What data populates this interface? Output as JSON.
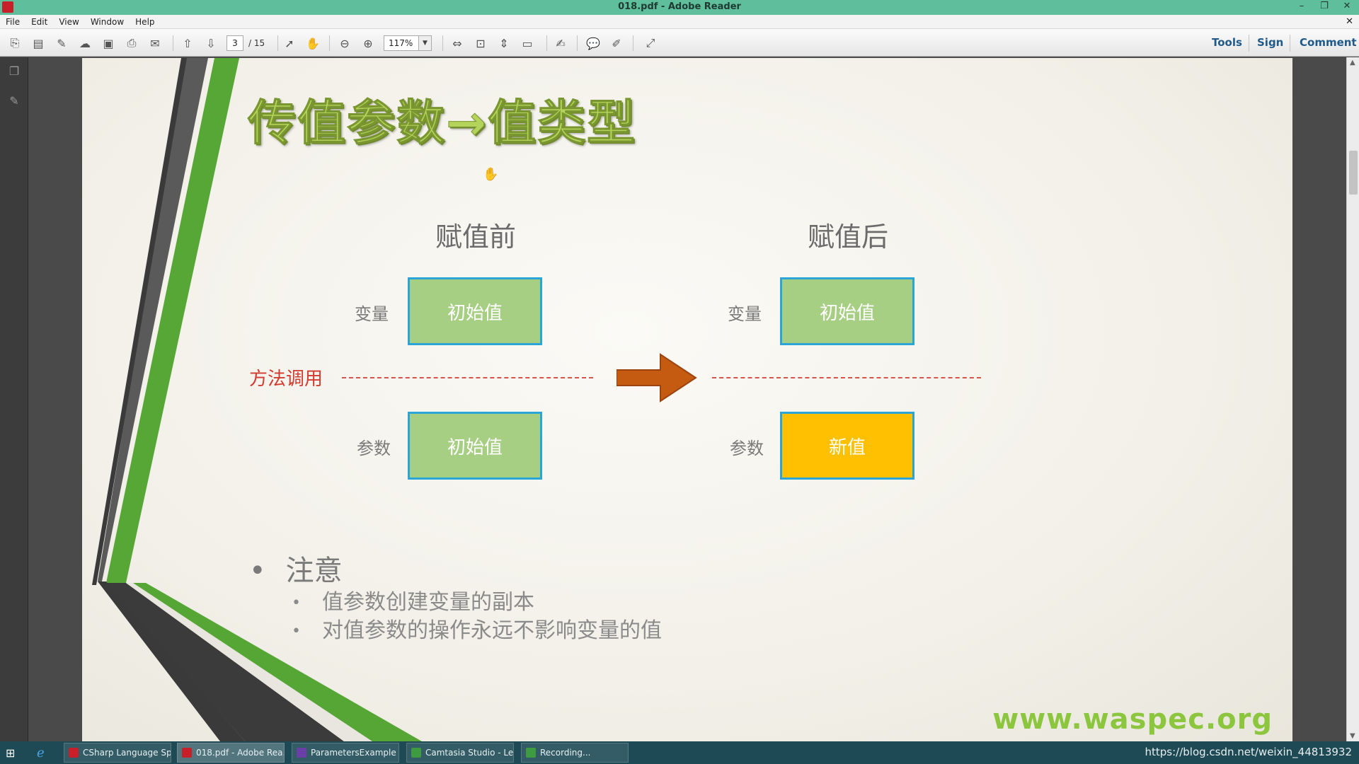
{
  "window": {
    "title": "018.pdf - Adobe Reader",
    "controls": [
      "–",
      "❐",
      "✕"
    ],
    "doc_close": "✕"
  },
  "menu": [
    "File",
    "Edit",
    "View",
    "Window",
    "Help"
  ],
  "toolbar": {
    "current_page": "3",
    "total_pages": "/ 15",
    "zoom": "117%",
    "zoom_dropdown": "▼",
    "tools_label": "Tools",
    "sign_label": "Sign",
    "comment_label": "Comment"
  },
  "slide": {
    "title": "传值参数→值类型",
    "before_heading": "赋值前",
    "after_heading": "赋值后",
    "variable_label": "变量",
    "parameter_label": "参数",
    "method_call_label": "方法调用",
    "before_variable_value": "初始值",
    "before_parameter_value": "初始值",
    "after_variable_value": "初始值",
    "after_parameter_value": "新值",
    "note_heading": "注意",
    "notes": [
      "值参数创建变量的副本",
      "对值参数的操作永远不影响变量的值"
    ],
    "watermark": "www.waspec.org",
    "bullet": "•"
  },
  "colors": {
    "title_green": "#b3d35a",
    "box_green": "#a6cf84",
    "box_orange": "#fec000",
    "box_border": "#2aa5d6",
    "call_red": "#d33a30",
    "arrow_orange": "#c55a11",
    "watermark_green": "#8cc63f"
  },
  "taskbar": {
    "tasks": [
      {
        "label": "CSharp Language Sp...",
        "icon": "pdf-icon"
      },
      {
        "label": "018.pdf - Adobe Rea...",
        "icon": "pdf-icon"
      },
      {
        "label": "ParametersExample -...",
        "icon": "visual-studio-icon"
      },
      {
        "label": "Camtasia Studio - Le...",
        "icon": "camtasia-icon"
      },
      {
        "label": "Recording...",
        "icon": "camtasia-icon"
      }
    ],
    "tray_text": "https://blog.csdn.net/weixin_44813932"
  }
}
